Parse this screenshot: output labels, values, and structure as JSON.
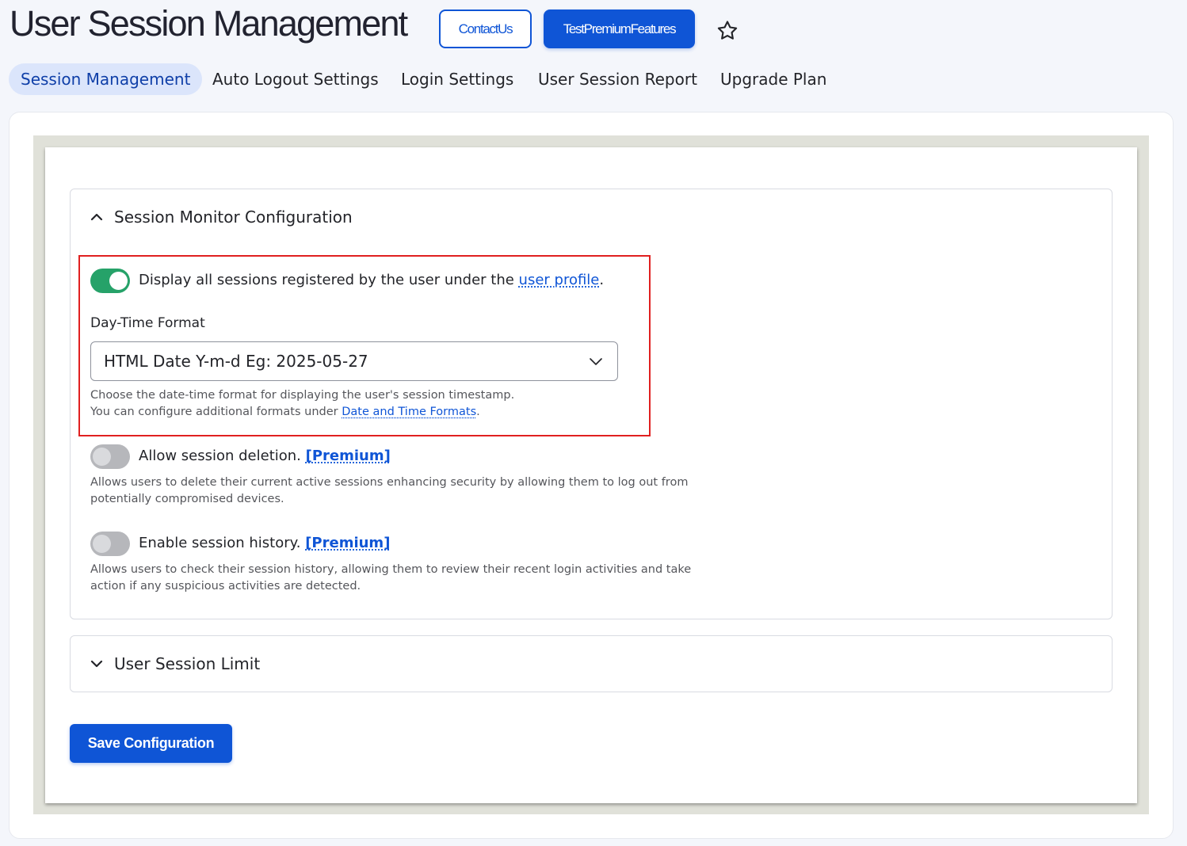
{
  "header": {
    "title": "User Session Management",
    "contact_label": "ContactUs",
    "premium_label": "TestPremiumFeatures"
  },
  "tabs": [
    {
      "label": "Session Management",
      "active": true
    },
    {
      "label": "Auto Logout Settings",
      "active": false
    },
    {
      "label": "Login Settings",
      "active": false
    },
    {
      "label": "User Session Report",
      "active": false
    },
    {
      "label": "Upgrade Plan",
      "active": false
    }
  ],
  "session_monitor": {
    "title": "Session Monitor Configuration",
    "expanded": true,
    "display_sessions": {
      "enabled": true,
      "label_prefix": "Display all sessions registered by the user under the ",
      "link_text": "user profile",
      "label_suffix": "."
    },
    "day_time_format": {
      "label": "Day-Time Format",
      "selected": "HTML Date Y-m-d Eg: 2025-05-27",
      "help_line1": "Choose the date-time format for displaying the user's session timestamp.",
      "help_line2_prefix": "You can configure additional formats under ",
      "help_line2_link": "Date and Time Formats",
      "help_line2_suffix": "."
    },
    "session_deletion": {
      "enabled": false,
      "label": "Allow session deletion. ",
      "premium": "[Premium]",
      "desc_line1": "Allows users to delete their current active sessions enhancing security by allowing them to log out from",
      "desc_line2": "potentially compromised devices."
    },
    "session_history": {
      "enabled": false,
      "label": "Enable session history. ",
      "premium": "[Premium]",
      "desc_line1": "Allows users to check their session history, allowing them to review their recent login activities and take",
      "desc_line2": "action if any suspicious activities are detected."
    }
  },
  "user_session_limit": {
    "title": "User Session Limit",
    "expanded": false
  },
  "save_label": "Save Configuration",
  "colors": {
    "primary": "#0f55d6",
    "toggle_on": "#26a269",
    "highlight_border": "#e02020",
    "active_tab_bg": "#dbe5fb"
  }
}
